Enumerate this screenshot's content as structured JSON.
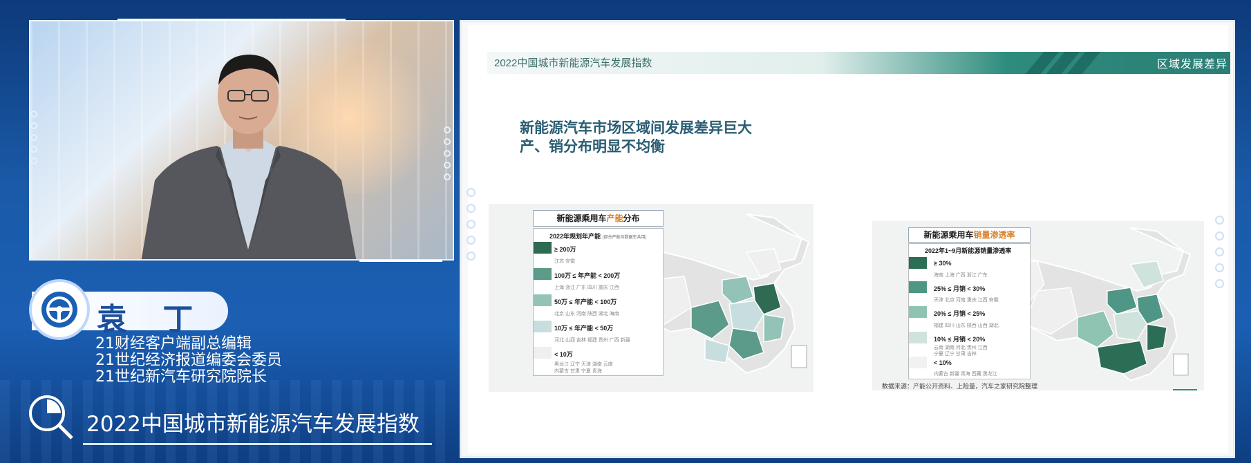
{
  "presenter": {
    "name": "袁 丁",
    "titles": [
      "21财经客户端副总编辑",
      "21世纪经济报道编委会委员",
      "21世纪新汽车研究院院长"
    ]
  },
  "program_title": "2022中国城市新能源汽车发展指数",
  "slide": {
    "header_left": "2022中国城市新能源汽车发展指数",
    "header_right": "区域发展差异",
    "title_lines": [
      "新能源汽车市场区域间发展差异巨大",
      "产、销分布明显不均衡"
    ],
    "accent_color": "#2b7e76",
    "left_map": {
      "legend_title_prefix": "新能源乘用车",
      "legend_title_highlight": "产能",
      "legend_title_suffix": "分布",
      "legend_subtitle": "2022年规划年产能",
      "legend_subtitle_note": "(部分产能与数据车共用)",
      "tiers": [
        {
          "label": "≥ 200万",
          "provinces": "江苏  安徽",
          "color": "#2f6a52"
        },
        {
          "label": "100万 ≤ 年产能 < 200万",
          "provinces": "上海  浙江  广东  四川  重庆  江西",
          "color": "#5c9a8a"
        },
        {
          "label": "50万 ≤ 年产能 < 100万",
          "provinces": "北京  山东  河南  陕西  湖北  海南",
          "color": "#93c3b6"
        },
        {
          "label": "10万 ≤ 年产能 < 50万",
          "provinces": "河北  山西  吉林  福建  贵州  广西  新疆",
          "color": "#c8dede"
        },
        {
          "label": "< 10万",
          "provinces": "黑龙江  辽宁  天津  湖南  云南",
          "provinces2": "内蒙古  甘肃  宁夏  青海",
          "color": "#efefef"
        }
      ]
    },
    "right_map": {
      "legend_title_prefix": "新能源乘用车",
      "legend_title_highlight": "销量渗透率",
      "legend_subtitle": "2022年1~9月新能源销量渗透率",
      "tiers": [
        {
          "label": "≥ 30%",
          "provinces": "海南  上海  广西  浙江  广东",
          "color": "#2c6e55"
        },
        {
          "label": "25% ≤ 月销 < 30%",
          "provinces": "天津  北京  河南  重庆  江西  安徽",
          "color": "#4f9686"
        },
        {
          "label": "20% ≤ 月销 < 25%",
          "provinces": "福建  四川  山东  陕西  山西  湖北",
          "color": "#8fc4b2"
        },
        {
          "label": "10% ≤ 月销 < 20%",
          "provinces": "云南  湖南  河北  贵州  江西",
          "provinces2": "宁夏  辽宁  甘肃  吉林",
          "color": "#cfe3dc"
        },
        {
          "label": "< 10%",
          "provinces": "内蒙古  新疆  青海  西藏  黑龙江",
          "color": "#f1f1f1"
        }
      ]
    },
    "source": "数据来源：产能公开资料、上险量，汽车之家研究院整理"
  }
}
